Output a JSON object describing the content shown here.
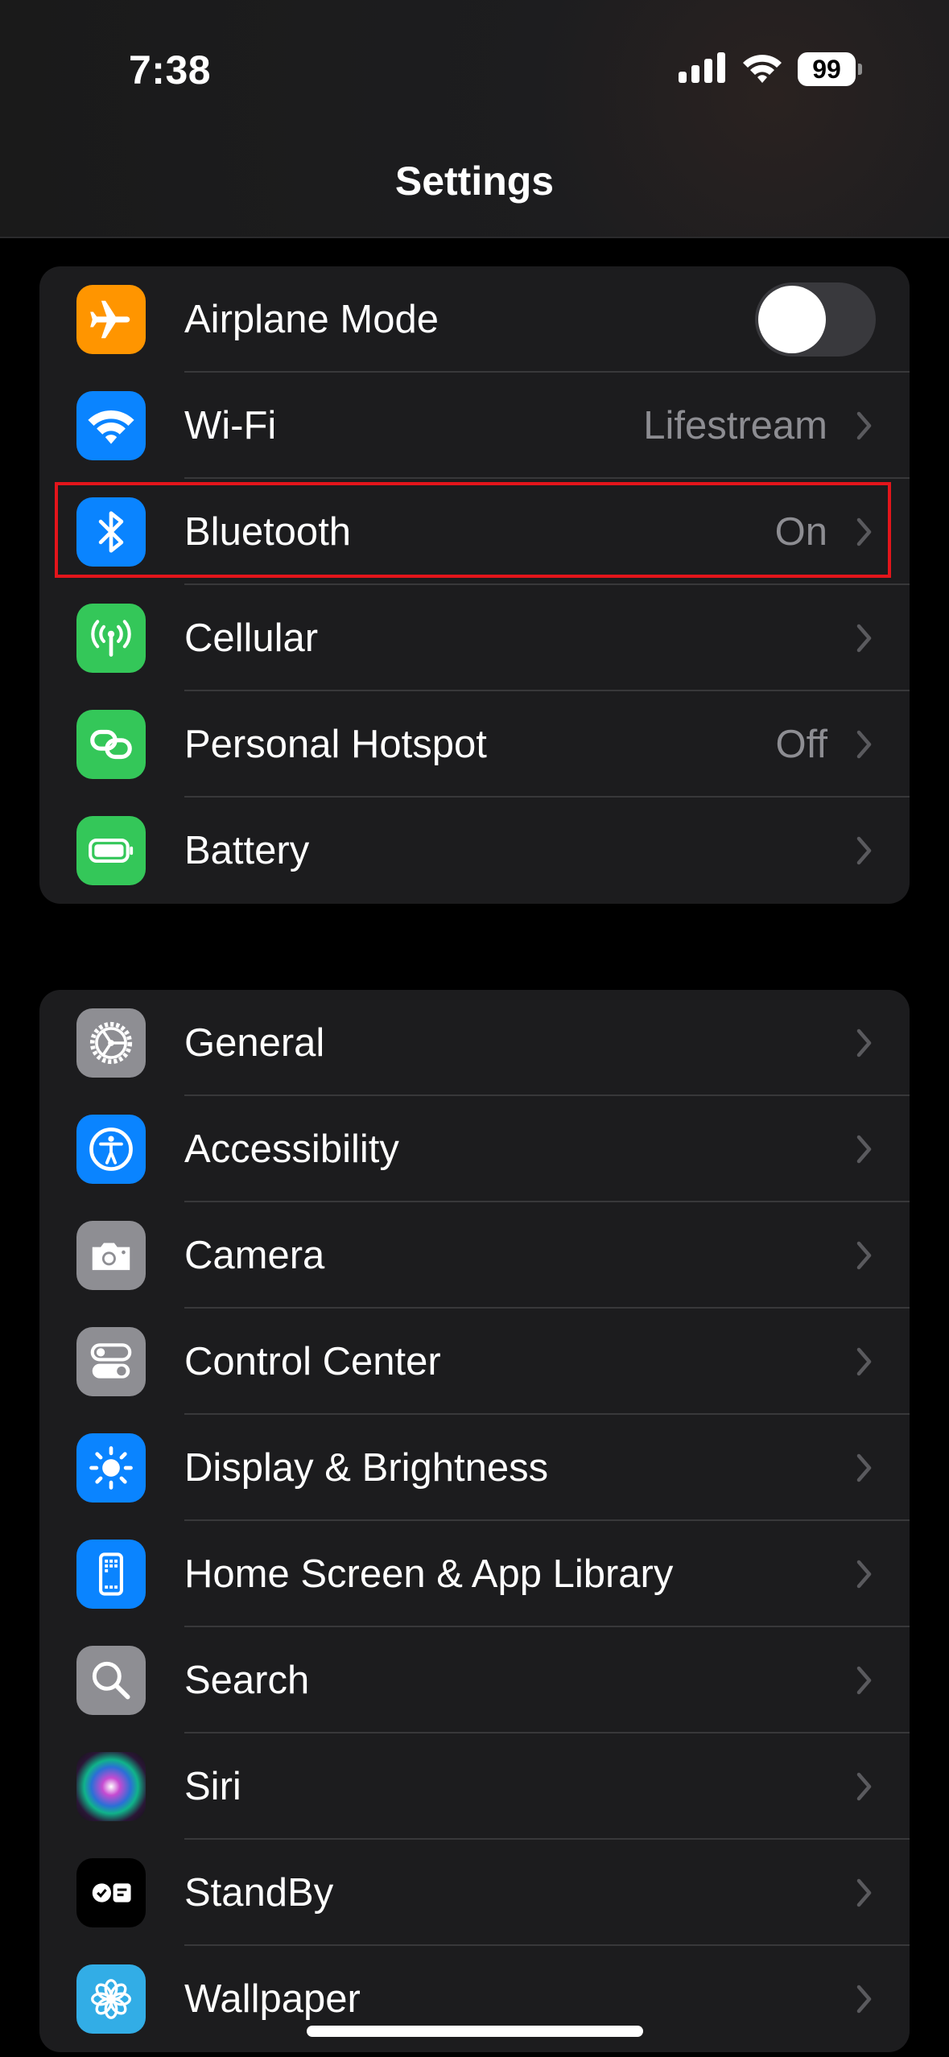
{
  "status_bar": {
    "time": "7:38",
    "signal_icon": "cellular-signal-icon",
    "wifi_icon": "wifi-icon",
    "battery_level": "99"
  },
  "header": {
    "title": "Settings"
  },
  "groups": [
    {
      "items": [
        {
          "label": "Airplane Mode",
          "icon": "airplane-icon",
          "icon_color": "#FF9500",
          "toggle": true,
          "toggle_on": false
        },
        {
          "label": "Wi-Fi",
          "icon": "wifi-icon",
          "icon_color": "#0A84FF",
          "value": "Lifestream"
        },
        {
          "label": "Bluetooth",
          "icon": "bluetooth-icon",
          "icon_color": "#0A84FF",
          "value": "On",
          "highlighted": true
        },
        {
          "label": "Cellular",
          "icon": "antenna-icon",
          "icon_color": "#34C759"
        },
        {
          "label": "Personal Hotspot",
          "icon": "link-icon",
          "icon_color": "#34C759",
          "value": "Off"
        },
        {
          "label": "Battery",
          "icon": "battery-icon",
          "icon_color": "#34C759"
        }
      ]
    },
    {
      "items": [
        {
          "label": "General",
          "icon": "gear-icon",
          "icon_color": "#8E8E93"
        },
        {
          "label": "Accessibility",
          "icon": "accessibility-icon",
          "icon_color": "#0A84FF"
        },
        {
          "label": "Camera",
          "icon": "camera-icon",
          "icon_color": "#8E8E93"
        },
        {
          "label": "Control Center",
          "icon": "switches-icon",
          "icon_color": "#8E8E93"
        },
        {
          "label": "Display & Brightness",
          "icon": "sun-icon",
          "icon_color": "#0A84FF"
        },
        {
          "label": "Home Screen & App Library",
          "icon": "phone-grid-icon",
          "icon_color": "#0A84FF"
        },
        {
          "label": "Search",
          "icon": "search-icon",
          "icon_color": "#8E8E93"
        },
        {
          "label": "Siri",
          "icon": "siri-icon",
          "icon_color": "#1C1C1E"
        },
        {
          "label": "StandBy",
          "icon": "standby-icon",
          "icon_color": "#000000"
        },
        {
          "label": "Wallpaper",
          "icon": "flower-icon",
          "icon_color": "#32ADE6"
        }
      ]
    }
  ],
  "colors": {
    "highlight_border": "#E3151B",
    "secondary_text": "#8D8D92",
    "cell_background": "#1C1C1E"
  }
}
